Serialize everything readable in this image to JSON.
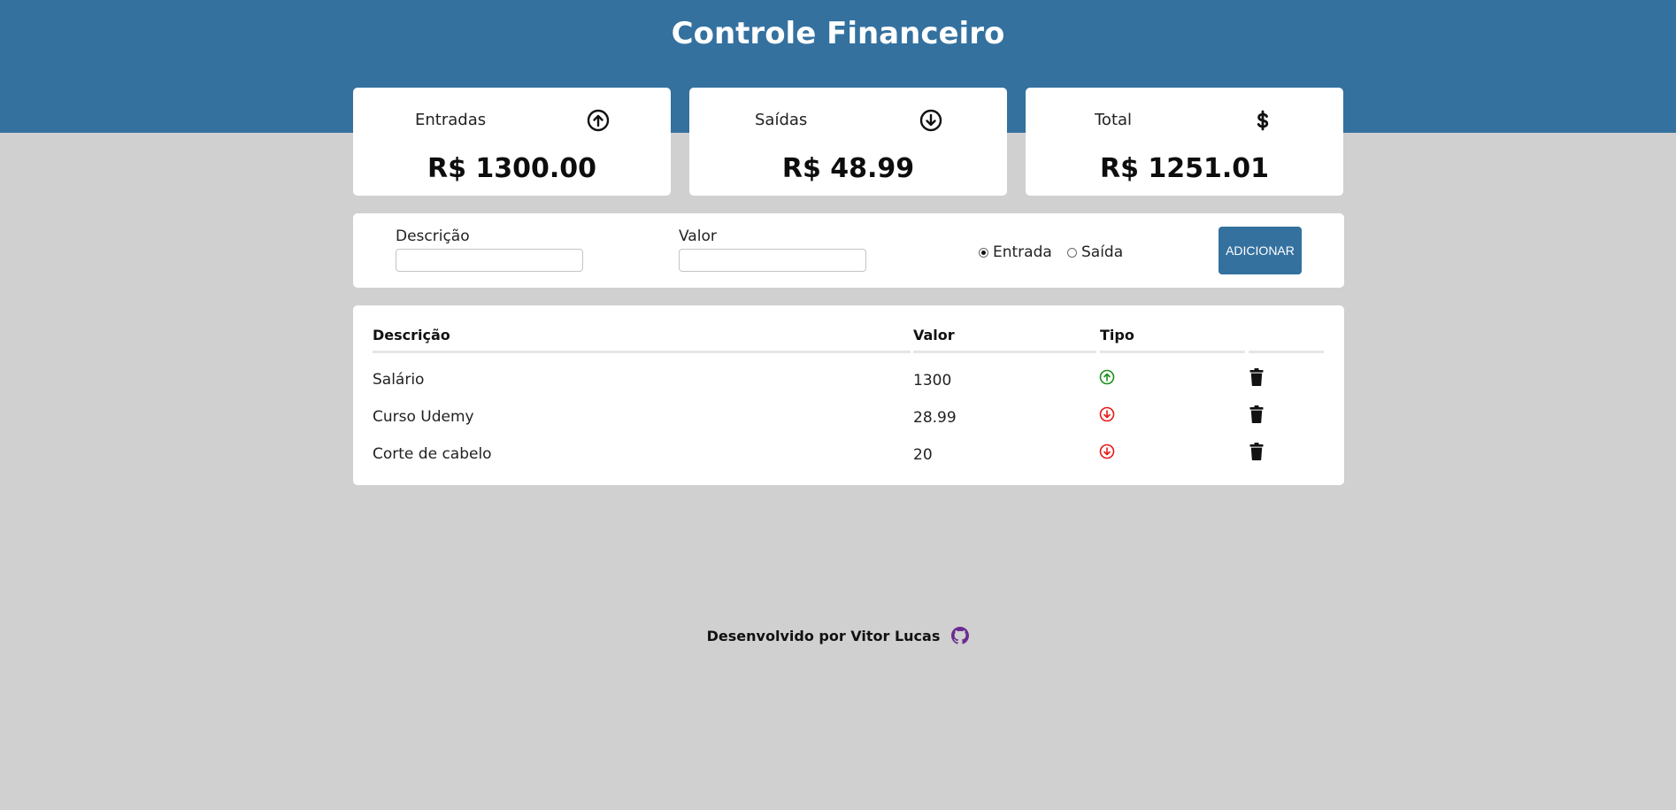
{
  "header": {
    "title": "Controle Financeiro",
    "color": "#34719f"
  },
  "summary": {
    "entradas": {
      "label": "Entradas",
      "value": "R$ 1300.00",
      "icon": "arrow-up-circle-icon"
    },
    "saidas": {
      "label": "Saídas",
      "value": "R$ 48.99",
      "icon": "arrow-down-circle-icon"
    },
    "total": {
      "label": "Total",
      "value": "R$ 1251.01",
      "icon": "dollar-icon"
    }
  },
  "form": {
    "descricao_label": "Descrição",
    "descricao_value": "",
    "valor_label": "Valor",
    "valor_value": "",
    "radio_entrada": "Entrada",
    "radio_saida": "Saída",
    "selected_type": "Entrada",
    "add_button": "ADICIONAR"
  },
  "table": {
    "headers": [
      "Descrição",
      "Valor",
      "Tipo"
    ],
    "rows": [
      {
        "descricao": "Salário",
        "valor": "1300",
        "tipo": "entrada",
        "tipo_icon": "arrow-up-circle-icon",
        "tipo_color": "#1e8e1e"
      },
      {
        "descricao": "Curso Udemy",
        "valor": "28.99",
        "tipo": "saida",
        "tipo_icon": "arrow-down-circle-icon",
        "tipo_color": "#e81818"
      },
      {
        "descricao": "Corte de cabelo",
        "valor": "20",
        "tipo": "saida",
        "tipo_icon": "arrow-down-circle-icon",
        "tipo_color": "#e81818"
      }
    ]
  },
  "footer": {
    "text": "Desenvolvido por Vitor Lucas",
    "icon": "github-icon",
    "icon_color": "#6a2c91"
  }
}
